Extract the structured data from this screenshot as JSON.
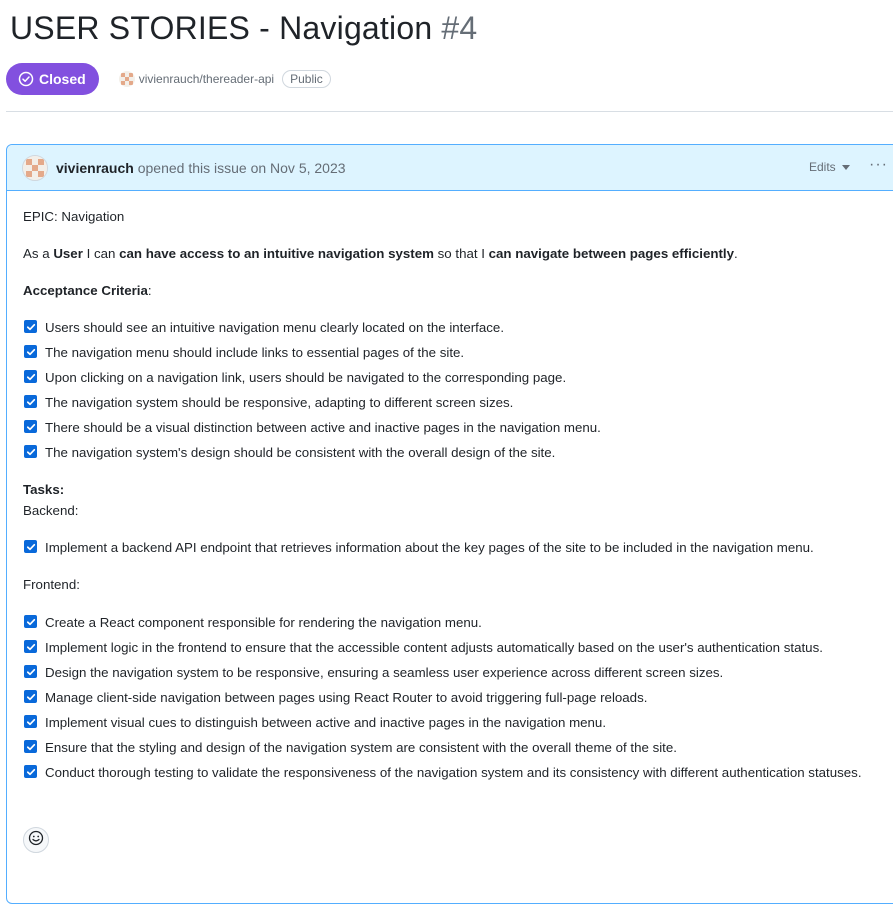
{
  "issue": {
    "title": "USER STORIES - Navigation",
    "number": "#4",
    "state": "Closed",
    "repo": "vivienrauch/thereader-api",
    "visibility": "Public"
  },
  "comment": {
    "author": "vivienrauch",
    "opened_text": "opened this issue on Nov 5, 2023",
    "edits_label": "Edits",
    "more_label": "···",
    "epic": "EPIC: Navigation",
    "story": {
      "part1": "As a ",
      "role": "User",
      "part2": " I can ",
      "capability": "can have access to an intuitive navigation system",
      "part3": " so that I ",
      "benefit": "can navigate between pages efficiently",
      "part4": "."
    },
    "acceptance_heading": "Acceptance Criteria",
    "acceptance_suffix": ":",
    "acceptance_items": [
      "Users should see an intuitive navigation menu clearly located on the interface.",
      "The navigation menu should include links to essential pages of the site.",
      "Upon clicking on a navigation link, users should be navigated to the corresponding page.",
      "The navigation system should be responsive, adapting to different screen sizes.",
      "There should be a visual distinction between active and inactive pages in the navigation menu.",
      "The navigation system's design should be consistent with the overall design of the site."
    ],
    "tasks_heading": "Tasks:",
    "backend_heading": "Backend:",
    "backend_items": [
      "Implement a backend API endpoint that retrieves information about the key pages of the site to be included in the navigation menu."
    ],
    "frontend_heading": "Frontend:",
    "frontend_items": [
      "Create a React component responsible for rendering the navigation menu.",
      "Implement logic in the frontend to ensure that the accessible content adjusts automatically based on the user's authentication status.",
      "Design the navigation system to be responsive, ensuring a seamless user experience across different screen sizes.",
      "Manage client-side navigation between pages using React Router to avoid triggering full-page reloads.",
      "Implement visual cues to distinguish between active and inactive pages in the navigation menu.",
      "Ensure that the styling and design of the navigation system are consistent with the overall theme of the site.",
      "Conduct thorough testing to validate the responsiveness of the navigation system and its consistency with different authentication statuses."
    ]
  },
  "colors": {
    "closed": "#8250df",
    "checkbox": "#0969da",
    "header_bg": "#ddf4ff",
    "border": "#54aeff"
  },
  "icons": [
    "check-circle-icon",
    "avatar-icon",
    "caret-down-icon",
    "kebab-icon",
    "checkbox-icon",
    "smiley-icon"
  ]
}
